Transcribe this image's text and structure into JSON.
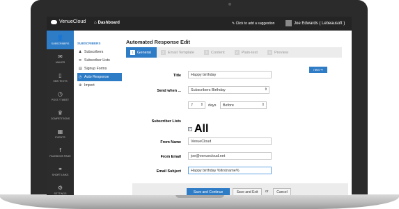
{
  "app": {
    "name": "VenueCloud"
  },
  "topbar": {
    "dashboard_label": "Dashboard",
    "suggestion_label": "Click to add a suggestion",
    "user_name": "Joe Edwards ( Lebeausoft )"
  },
  "sidebar": {
    "items": [
      {
        "label": "SUBSCRIBERS",
        "icon": "user-icon",
        "glyph": "👤",
        "active": true
      },
      {
        "label": "MAILER",
        "icon": "envelope-icon",
        "glyph": "✉",
        "active": false
      },
      {
        "label": "SMS TEXTS",
        "icon": "phone-icon",
        "glyph": "▯",
        "active": false
      },
      {
        "label": "POST / TWEET",
        "icon": "clock-icon",
        "glyph": "◷",
        "active": false
      },
      {
        "label": "COMPETITIONS",
        "icon": "trophy-icon",
        "glyph": "♛",
        "active": false
      },
      {
        "label": "EVENTS",
        "icon": "calendar-icon",
        "glyph": "▦",
        "active": false
      },
      {
        "label": "FACEBOOK PAGE",
        "icon": "facebook-icon",
        "glyph": "f",
        "active": false
      },
      {
        "label": "SHORT LINKS",
        "icon": "link-icon",
        "glyph": "⚭",
        "active": false
      },
      {
        "label": "SETTINGS",
        "icon": "gears-icon",
        "glyph": "⚙",
        "active": false
      }
    ]
  },
  "submenu": {
    "heading": "SUBSCRIBERS",
    "items": [
      {
        "label": "Subscribers",
        "icon": "user-icon",
        "glyph": "♟",
        "active": false
      },
      {
        "label": "Subscriber Lists",
        "icon": "list-icon",
        "glyph": "≡",
        "active": false
      },
      {
        "label": "Signup Forms",
        "icon": "form-icon",
        "glyph": "▤",
        "active": false
      },
      {
        "label": "Auto Response",
        "icon": "clock-icon",
        "glyph": "◷",
        "active": true
      },
      {
        "label": "Import",
        "icon": "import-icon",
        "glyph": "⊕",
        "active": false
      }
    ]
  },
  "main": {
    "title": "Automated Response Edit",
    "tabs": [
      {
        "num": "1",
        "label": "General",
        "active": true
      },
      {
        "num": "2",
        "label": "Email Template",
        "active": false
      },
      {
        "num": "3",
        "label": "Content",
        "active": false
      },
      {
        "num": "4",
        "label": "Plain-text",
        "active": false
      },
      {
        "num": "5",
        "label": "Preview",
        "active": false
      }
    ],
    "next_label": "next ➔"
  },
  "form": {
    "title_label": "Title",
    "title_value": "Happy birthday",
    "send_when_label": "Send when ...",
    "send_when_value": "Subscribers Birthday",
    "days_value": "7",
    "days_label": "days",
    "before_value": "Before",
    "lists_label": "Subscriber Lists",
    "all_label": "All",
    "from_name_label": "From Name",
    "from_name_value": "VenueCloud",
    "from_email_label": "From Email",
    "from_email_value": "joe@venuecloud.net",
    "subject_label": "Email Subject",
    "subject_value": "Happy birthday %firstname%"
  },
  "buttons": {
    "save_continue": "Save and Continue",
    "save_exit": "Save and Exit",
    "or": "or",
    "cancel": "Cancel"
  }
}
